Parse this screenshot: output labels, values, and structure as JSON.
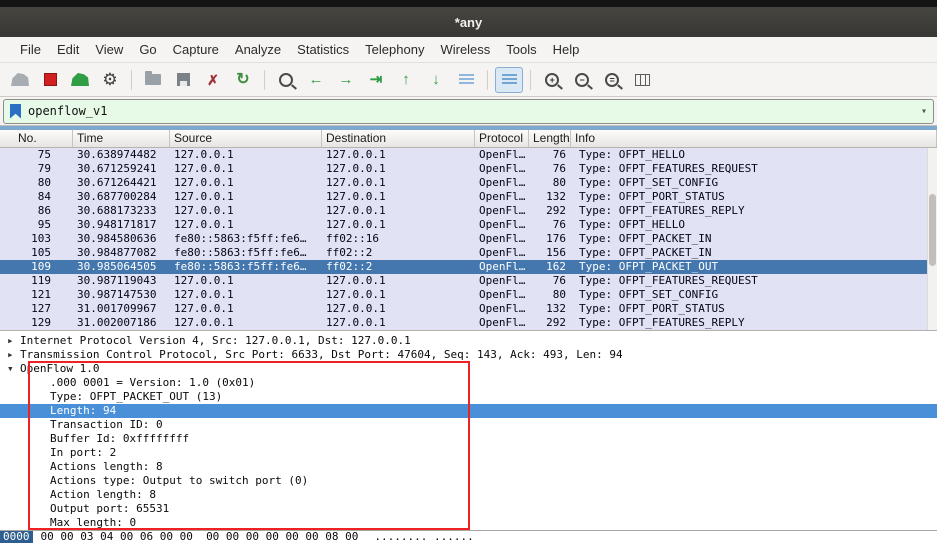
{
  "window": {
    "title": "*any"
  },
  "menubar": {
    "items": [
      "File",
      "Edit",
      "View",
      "Go",
      "Capture",
      "Analyze",
      "Statistics",
      "Telephony",
      "Wireless",
      "Tools",
      "Help"
    ]
  },
  "toolbar": {
    "icons": [
      "capture-start",
      "capture-stop",
      "capture-restart",
      "capture-options",
      "open-file",
      "save-file",
      "close-file",
      "reload",
      "find-packet",
      "go-back",
      "go-forward",
      "go-to-packet",
      "go-to-first",
      "go-to-last",
      "auto-scroll",
      "colorize-packets",
      "zoom-in",
      "zoom-out",
      "zoom-reset",
      "resize-columns"
    ]
  },
  "filter": {
    "value": "openflow_v1",
    "chevron": "▾"
  },
  "packet_list": {
    "columns": [
      "No.",
      "Time",
      "Source",
      "Destination",
      "Protocol",
      "Length",
      "Info"
    ],
    "rows": [
      {
        "no": "75",
        "time": "30.638974482",
        "source": "127.0.0.1",
        "destination": "127.0.0.1",
        "protocol": "OpenFl…",
        "length": "76",
        "info": "Type: OFPT_HELLO",
        "selected": false
      },
      {
        "no": "79",
        "time": "30.671259241",
        "source": "127.0.0.1",
        "destination": "127.0.0.1",
        "protocol": "OpenFl…",
        "length": "76",
        "info": "Type: OFPT_FEATURES_REQUEST",
        "selected": false
      },
      {
        "no": "80",
        "time": "30.671264421",
        "source": "127.0.0.1",
        "destination": "127.0.0.1",
        "protocol": "OpenFl…",
        "length": "80",
        "info": "Type: OFPT_SET_CONFIG",
        "selected": false
      },
      {
        "no": "84",
        "time": "30.687700284",
        "source": "127.0.0.1",
        "destination": "127.0.0.1",
        "protocol": "OpenFl…",
        "length": "132",
        "info": "Type: OFPT_PORT_STATUS",
        "selected": false
      },
      {
        "no": "86",
        "time": "30.688173233",
        "source": "127.0.0.1",
        "destination": "127.0.0.1",
        "protocol": "OpenFl…",
        "length": "292",
        "info": "Type: OFPT_FEATURES_REPLY",
        "selected": false
      },
      {
        "no": "95",
        "time": "30.948171817",
        "source": "127.0.0.1",
        "destination": "127.0.0.1",
        "protocol": "OpenFl…",
        "length": "76",
        "info": "Type: OFPT_HELLO",
        "selected": false
      },
      {
        "no": "103",
        "time": "30.984580636",
        "source": "fe80::5863:f5ff:fe6…",
        "destination": "ff02::16",
        "protocol": "OpenFl…",
        "length": "176",
        "info": "Type: OFPT_PACKET_IN",
        "selected": false
      },
      {
        "no": "105",
        "time": "30.984877082",
        "source": "fe80::5863:f5ff:fe6…",
        "destination": "ff02::2",
        "protocol": "OpenFl…",
        "length": "156",
        "info": "Type: OFPT_PACKET_IN",
        "selected": false
      },
      {
        "no": "109",
        "time": "30.985064505",
        "source": "fe80::5863:f5ff:fe6…",
        "destination": "ff02::2",
        "protocol": "OpenFl…",
        "length": "162",
        "info": "Type: OFPT_PACKET_OUT",
        "selected": true
      },
      {
        "no": "119",
        "time": "30.987119043",
        "source": "127.0.0.1",
        "destination": "127.0.0.1",
        "protocol": "OpenFl…",
        "length": "76",
        "info": "Type: OFPT_FEATURES_REQUEST",
        "selected": false
      },
      {
        "no": "121",
        "time": "30.987147530",
        "source": "127.0.0.1",
        "destination": "127.0.0.1",
        "protocol": "OpenFl…",
        "length": "80",
        "info": "Type: OFPT_SET_CONFIG",
        "selected": false
      },
      {
        "no": "127",
        "time": "31.001709967",
        "source": "127.0.0.1",
        "destination": "127.0.0.1",
        "protocol": "OpenFl…",
        "length": "132",
        "info": "Type: OFPT_PORT_STATUS",
        "selected": false
      },
      {
        "no": "129",
        "time": "31.002007186",
        "source": "127.0.0.1",
        "destination": "127.0.0.1",
        "protocol": "OpenFl…",
        "length": "292",
        "info": "Type: OFPT_FEATURES_REPLY",
        "selected": false
      }
    ]
  },
  "detail": {
    "lines": [
      {
        "twisty": "▸",
        "text": "Internet Protocol Version 4, Src: 127.0.0.1, Dst: 127.0.0.1"
      },
      {
        "twisty": "▸",
        "text": "Transmission Control Protocol, Src Port: 6633, Dst Port: 47604, Seq: 143, Ack: 493, Len: 94"
      },
      {
        "twisty": "▾",
        "text": "OpenFlow 1.0"
      }
    ],
    "openflow": [
      ".000 0001 = Version: 1.0 (0x01)",
      "Type: OFPT_PACKET_OUT (13)",
      "Length: 94",
      "Transaction ID: 0",
      "Buffer Id: 0xffffffff",
      "In port: 2",
      "Actions length: 8",
      "Actions type: Output to switch port (0)",
      "Action length: 8",
      "Output port: 65531",
      "Max length: 0"
    ],
    "selected_field": "Length: 94"
  },
  "hex": {
    "offset": "0000",
    "bytes": "00 00 03 04 00 06 00 00  00 00 00 00 00 00 08 00",
    "ascii": "........ ......"
  },
  "colors": {
    "selection_blue": "#4a90d9",
    "list_selection_blue": "#4477ad",
    "row_lavender": "#e2e2f5",
    "annotation_red": "#ee2222",
    "filter_valid_green": "#e7f9e7",
    "titlebar": "#3a3834"
  }
}
